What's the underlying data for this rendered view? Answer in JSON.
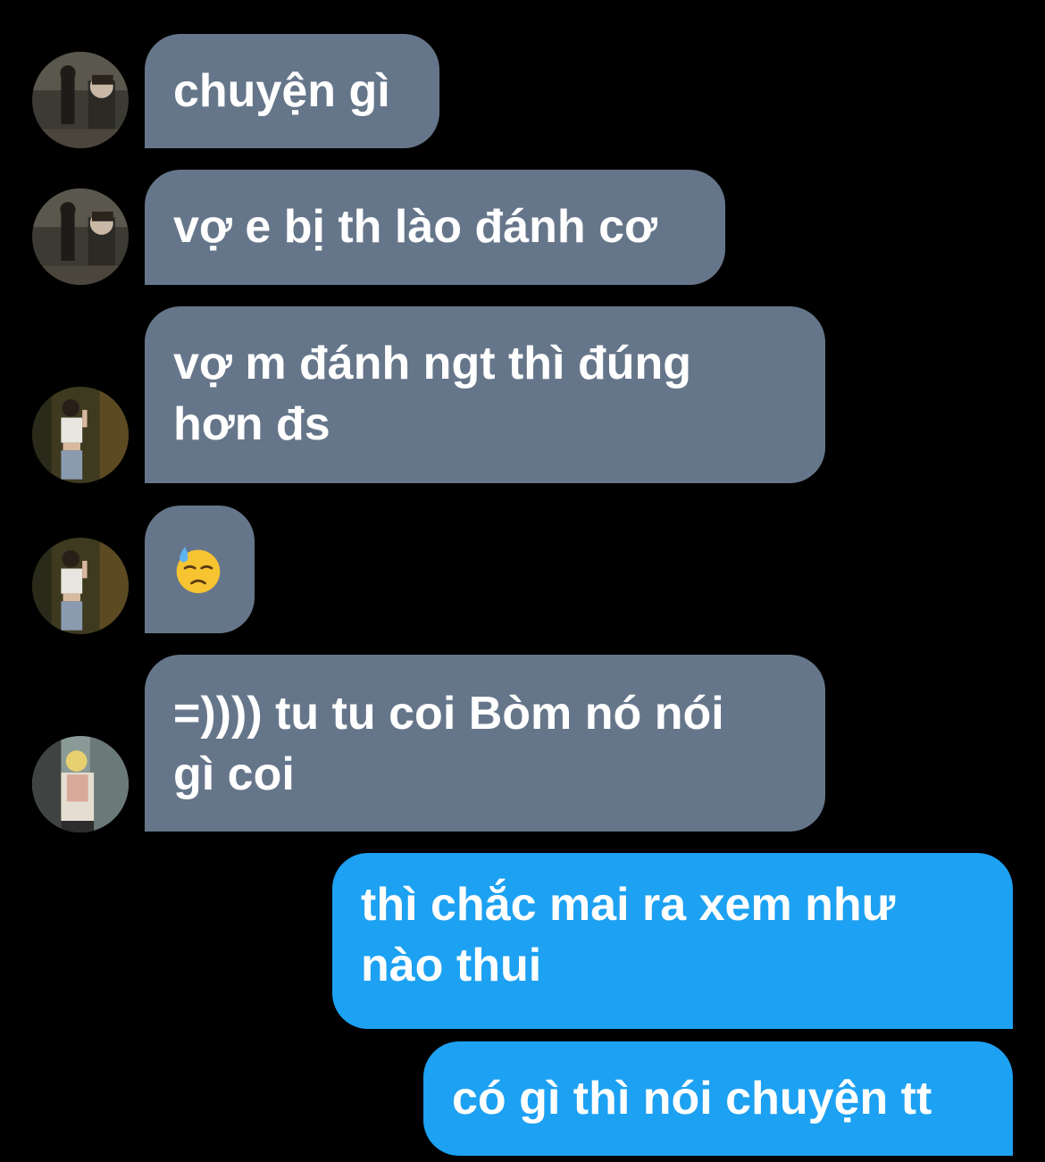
{
  "messages": [
    {
      "id": 1,
      "direction": "incoming",
      "sender": "user-a",
      "lines": [
        "chuyện gì"
      ]
    },
    {
      "id": 2,
      "direction": "incoming",
      "sender": "user-a",
      "lines": [
        "vợ e bị th lào đánh cơ"
      ]
    },
    {
      "id": 3,
      "direction": "incoming",
      "sender": "user-b",
      "lines": [
        "vợ m đánh ngt thì đúng",
        "hơn đs"
      ]
    },
    {
      "id": 4,
      "direction": "incoming",
      "sender": "user-b",
      "emoji": "downcast-face-with-sweat-icon"
    },
    {
      "id": 5,
      "direction": "incoming",
      "sender": "user-c",
      "lines": [
        "=)))) tu tu coi Bòm nó nói",
        "gì coi"
      ]
    },
    {
      "id": 6,
      "direction": "outgoing",
      "lines": [
        "thì chắc mai ra xem như",
        "nào thui"
      ]
    },
    {
      "id": 7,
      "direction": "outgoing",
      "lines": [
        "có gì thì nói chuyện tt"
      ]
    }
  ],
  "colors": {
    "background": "#000000",
    "incoming_bubble": "#66768a",
    "outgoing_bubble": "#1da1f2",
    "text": "#ffffff"
  }
}
